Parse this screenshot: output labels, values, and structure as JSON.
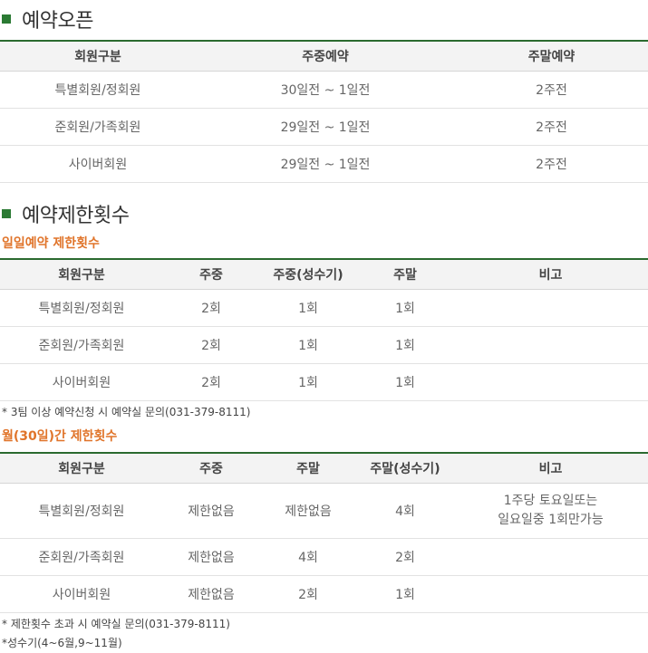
{
  "open": {
    "title": "예약오픈",
    "headers": [
      "회원구분",
      "주중예약",
      "주말예약"
    ],
    "rows": [
      [
        "특별회원/정회원",
        "30일전 ~ 1일전",
        "2주전"
      ],
      [
        "준회원/가족회원",
        "29일전 ~ 1일전",
        "2주전"
      ],
      [
        "사이버회원",
        "29일전 ~ 1일전",
        "2주전"
      ]
    ]
  },
  "limit": {
    "title": "예약제한횟수",
    "daily": {
      "subtitle": "일일예약 제한횟수",
      "headers": [
        "회원구분",
        "주중",
        "주중(성수기)",
        "주말",
        "비고"
      ],
      "rows": [
        [
          "특별회원/정회원",
          "2회",
          "1회",
          "1회",
          ""
        ],
        [
          "준회원/가족회원",
          "2회",
          "1회",
          "1회",
          ""
        ],
        [
          "사이버회원",
          "2회",
          "1회",
          "1회",
          ""
        ]
      ],
      "note": "* 3팀 이상 예약신청 시 예약실 문의(031-379-8111)"
    },
    "monthly": {
      "subtitle": "월(30일)간 제한횟수",
      "headers": [
        "회원구분",
        "주중",
        "주말",
        "주말(성수기)",
        "비고"
      ],
      "rows": [
        [
          "특별회원/정회원",
          "제한없음",
          "제한없음",
          "4회",
          "1주당 토요일또는\n일요일중 1회만가능"
        ],
        [
          "준회원/가족회원",
          "제한없음",
          "4회",
          "2회",
          ""
        ],
        [
          "사이버회원",
          "제한없음",
          "2회",
          "1회",
          ""
        ]
      ],
      "notes": [
        "* 제한횟수 초과 시 예약실 문의(031-379-8111)",
        "*성수기(4~6월,9~11월)"
      ]
    }
  },
  "colors": {
    "bullet": "#2b7a33",
    "header_border": "#2b6a2f",
    "subtitle": "#e0742a"
  }
}
